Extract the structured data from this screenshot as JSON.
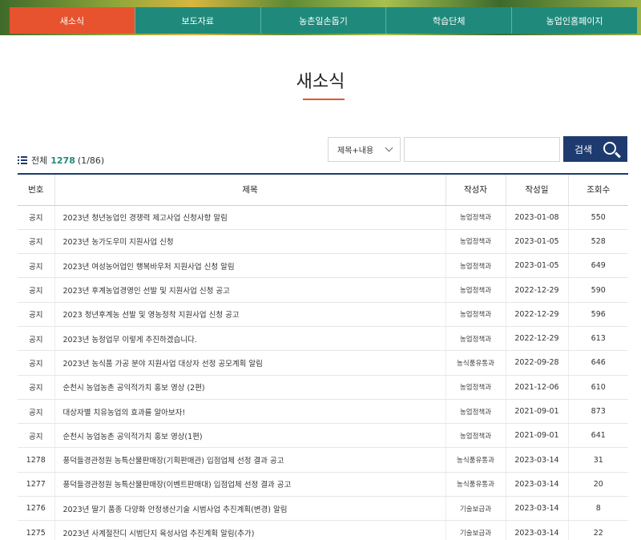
{
  "nav": {
    "items": [
      {
        "label": "새소식",
        "active": true
      },
      {
        "label": "보도자료",
        "active": false
      },
      {
        "label": "농촌일손돕기",
        "active": false
      },
      {
        "label": "학습단체",
        "active": false
      },
      {
        "label": "농업인홈페이지",
        "active": false
      }
    ]
  },
  "page": {
    "title": "새소식"
  },
  "summary": {
    "total_label": "전체",
    "total_count": "1278",
    "page_info": "(1/86)"
  },
  "search": {
    "select_value": "제목+내용",
    "input_value": "",
    "button_label": "검색"
  },
  "colors": {
    "accent": "#e8532f",
    "nav": "#1f8a7c",
    "navy": "#1d3b6e"
  },
  "table": {
    "headers": [
      "번호",
      "제목",
      "작성자",
      "작성일",
      "조회수"
    ],
    "rows": [
      {
        "no": "공지",
        "title": "2023년 청년농업인 경쟁력 제고사업 신청사항 알림",
        "author": "농업정책과",
        "date": "2023-01-08",
        "views": "550"
      },
      {
        "no": "공지",
        "title": "2023년 농가도우미 지원사업 신청",
        "author": "농업정책과",
        "date": "2023-01-05",
        "views": "528"
      },
      {
        "no": "공지",
        "title": "2023년 여성농어업인 행복바우처 지원사업 신청 알림",
        "author": "농업정책과",
        "date": "2023-01-05",
        "views": "649"
      },
      {
        "no": "공지",
        "title": "2023년 후계농업경영인 선발 및 지원사업 신청 공고",
        "author": "농업정책과",
        "date": "2022-12-29",
        "views": "590"
      },
      {
        "no": "공지",
        "title": "2023 청년후계농 선발 및 영농정착 지원사업 신청 공고",
        "author": "농업정책과",
        "date": "2022-12-29",
        "views": "596"
      },
      {
        "no": "공지",
        "title": "2023년 농정업무 이렇게 추진하겠습니다.",
        "author": "농업정책과",
        "date": "2022-12-29",
        "views": "613"
      },
      {
        "no": "공지",
        "title": "2023년 농식품 가공 분야 지원사업 대상자 선정 공모계획 알림",
        "author": "농식품유통과",
        "date": "2022-09-28",
        "views": "646"
      },
      {
        "no": "공지",
        "title": "순천시 농업농촌 공익적가치 홍보 영상 (2편)",
        "author": "농업정책과",
        "date": "2021-12-06",
        "views": "610"
      },
      {
        "no": "공지",
        "title": "대상자별 치유농업의 효과를 알아보자!",
        "author": "농업정책과",
        "date": "2021-09-01",
        "views": "873"
      },
      {
        "no": "공지",
        "title": "순천시 농업농촌 공익적가치 홍보 영상(1편)",
        "author": "농업정책과",
        "date": "2021-09-01",
        "views": "641"
      },
      {
        "no": "1278",
        "title": "풍덕들경관정원 농특산물판매장(기획판매관) 입점업체 선정 결과 공고",
        "author": "농식품유통과",
        "date": "2023-03-14",
        "views": "31"
      },
      {
        "no": "1277",
        "title": "풍덕들경관정원 농특산물판매장(이벤트판매대) 입점업체 선정 결과 공고",
        "author": "농식품유통과",
        "date": "2023-03-14",
        "views": "20"
      },
      {
        "no": "1276",
        "title": "2023년 딸기 품종 다양화 안정생산기술 시범사업 추진계획(변경) 알림",
        "author": "기술보급과",
        "date": "2023-03-14",
        "views": "8"
      },
      {
        "no": "1275",
        "title": "2023년 사계절잔디 시범단지 육성사업 추진계획 알림(추가)",
        "author": "기술보급과",
        "date": "2023-03-14",
        "views": "22"
      }
    ]
  }
}
